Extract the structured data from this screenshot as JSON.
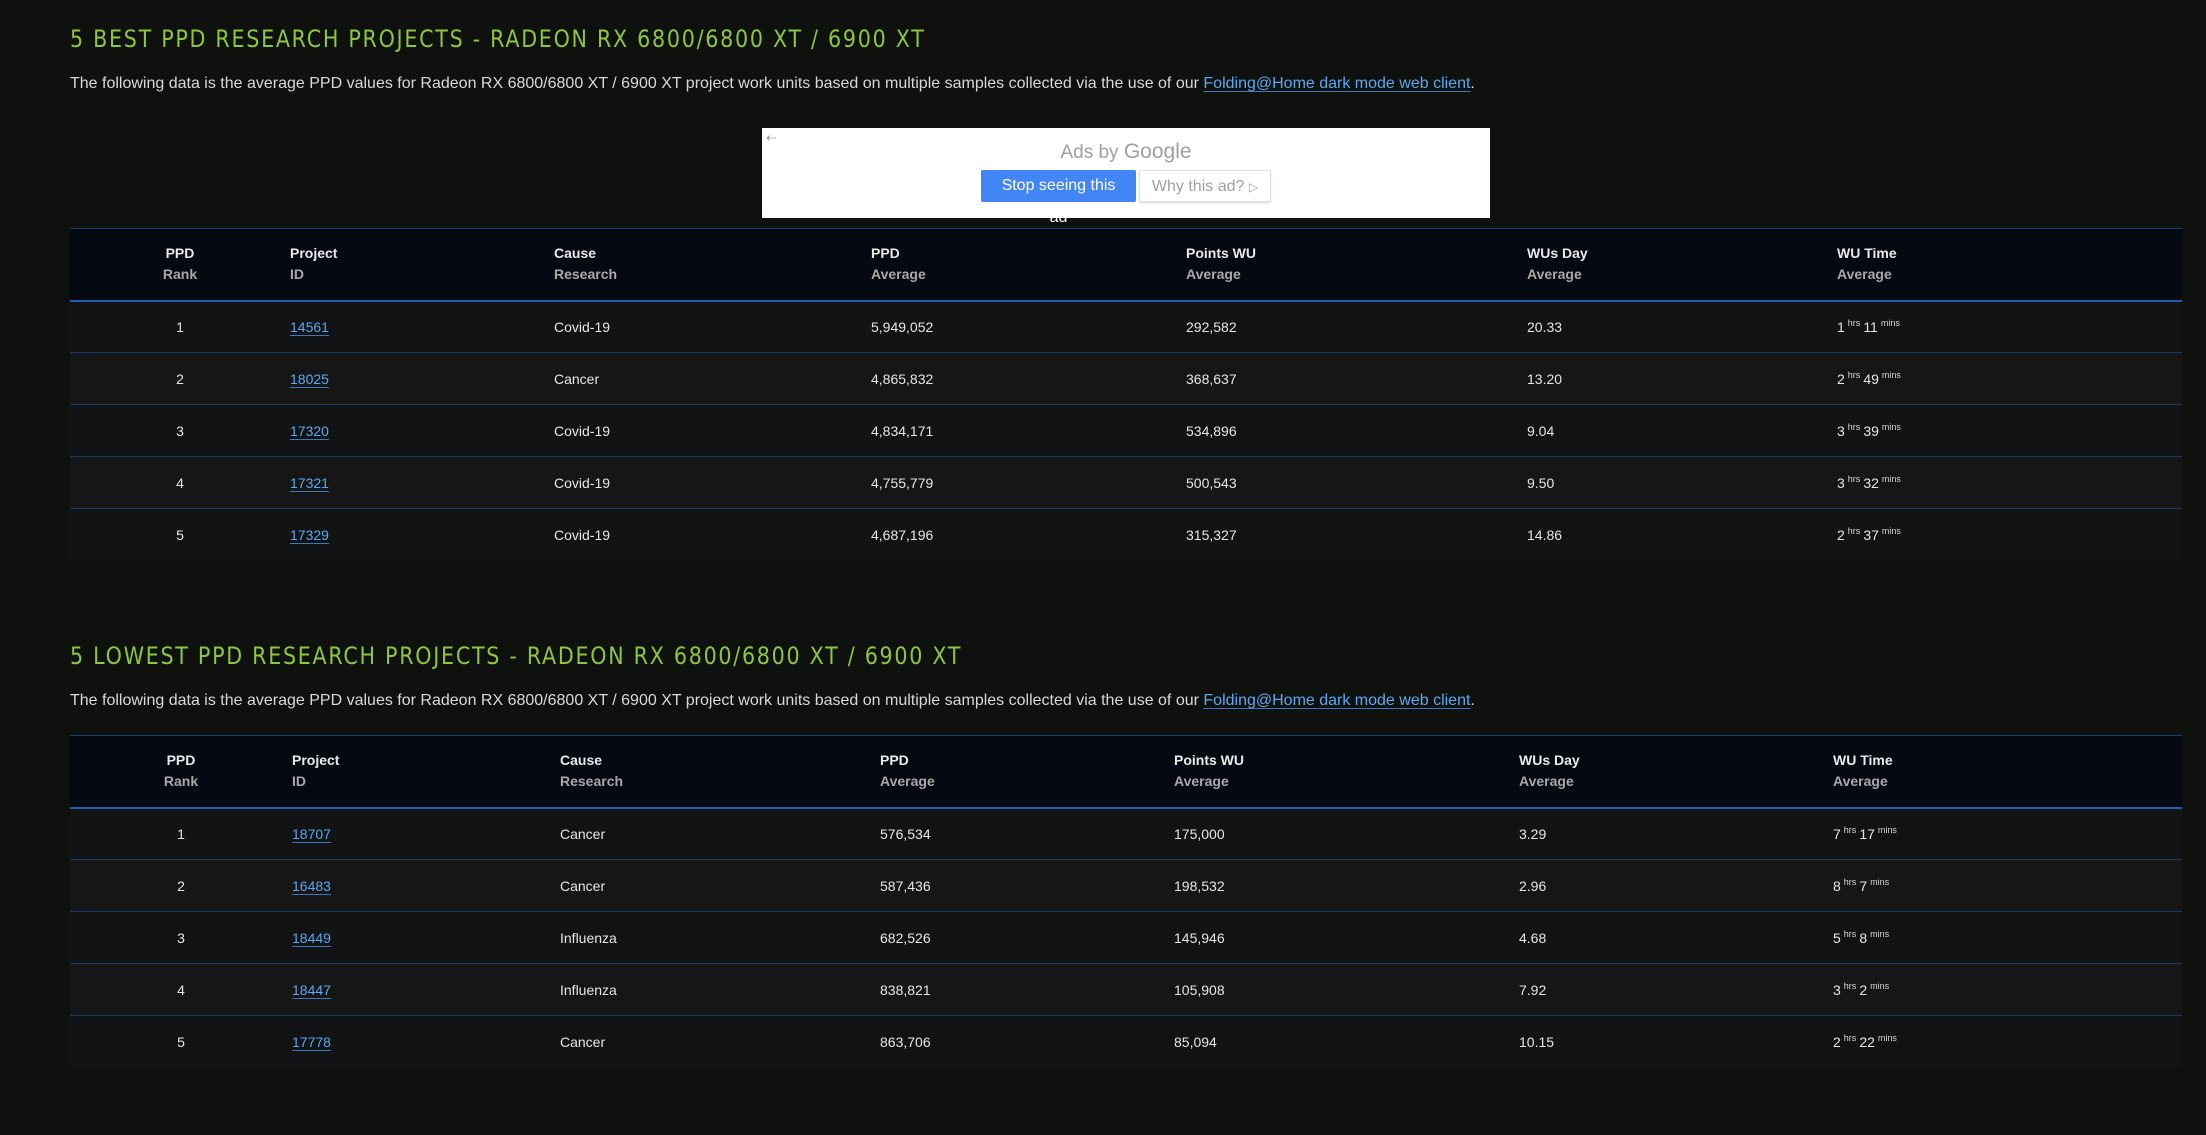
{
  "best": {
    "title": "5 BEST PPD RESEARCH PROJECTS - RADEON RX 6800/6800 XT / 6900 XT",
    "description": "The following data is the average PPD values for Radeon RX 6800/6800 XT / 6900 XT project work units based on multiple samples collected via the use of our ",
    "link_text": "Folding@Home dark mode web client",
    "description_end": ".",
    "rows": [
      {
        "rank": "1",
        "project": "14561",
        "cause": "Covid-19",
        "ppd": "5,949,052",
        "points": "292,582",
        "wus": "20.33",
        "hrs": "1",
        "mins": "11"
      },
      {
        "rank": "2",
        "project": "18025",
        "cause": "Cancer",
        "ppd": "4,865,832",
        "points": "368,637",
        "wus": "13.20",
        "hrs": "2",
        "mins": "49"
      },
      {
        "rank": "3",
        "project": "17320",
        "cause": "Covid-19",
        "ppd": "4,834,171",
        "points": "534,896",
        "wus": "9.04",
        "hrs": "3",
        "mins": "39"
      },
      {
        "rank": "4",
        "project": "17321",
        "cause": "Covid-19",
        "ppd": "4,755,779",
        "points": "500,543",
        "wus": "9.50",
        "hrs": "3",
        "mins": "32"
      },
      {
        "rank": "5",
        "project": "17329",
        "cause": "Covid-19",
        "ppd": "4,687,196",
        "points": "315,327",
        "wus": "14.86",
        "hrs": "2",
        "mins": "37"
      }
    ]
  },
  "lowest": {
    "title": "5 LOWEST PPD RESEARCH PROJECTS - RADEON RX 6800/6800 XT / 6900 XT",
    "description": "The following data is the average PPD values for Radeon RX 6800/6800 XT / 6900 XT project work units based on multiple samples collected via the use of our ",
    "link_text": "Folding@Home dark mode web client",
    "description_end": ".",
    "rows": [
      {
        "rank": "1",
        "project": "18707",
        "cause": "Cancer",
        "ppd": "576,534",
        "points": "175,000",
        "wus": "3.29",
        "hrs": "7",
        "mins": "17"
      },
      {
        "rank": "2",
        "project": "16483",
        "cause": "Cancer",
        "ppd": "587,436",
        "points": "198,532",
        "wus": "2.96",
        "hrs": "8",
        "mins": "7"
      },
      {
        "rank": "3",
        "project": "18449",
        "cause": "Influenza",
        "ppd": "682,526",
        "points": "145,946",
        "wus": "4.68",
        "hrs": "5",
        "mins": "8"
      },
      {
        "rank": "4",
        "project": "18447",
        "cause": "Influenza",
        "ppd": "838,821",
        "points": "105,908",
        "wus": "7.92",
        "hrs": "3",
        "mins": "2"
      },
      {
        "rank": "5",
        "project": "17778",
        "cause": "Cancer",
        "ppd": "863,706",
        "points": "85,094",
        "wus": "10.15",
        "hrs": "2",
        "mins": "22"
      }
    ]
  },
  "table_headers": {
    "rank": [
      "PPD",
      "Rank"
    ],
    "project": [
      "Project",
      "ID"
    ],
    "cause": [
      "Cause",
      "Research"
    ],
    "ppd": [
      "PPD",
      "Average"
    ],
    "points": [
      "Points WU",
      "Average"
    ],
    "wus": [
      "WUs Day",
      "Average"
    ],
    "time": [
      "WU Time",
      "Average"
    ]
  },
  "time_units": {
    "hrs": "hrs",
    "mins": "mins"
  },
  "ad": {
    "back_icon": "back-arrow-icon",
    "label_prefix": "Ads by ",
    "label_brand": "Google",
    "stop_button": "Stop seeing this ad",
    "why_button": "Why this ad?",
    "why_icon": "play-icon",
    "colors": {
      "primary": "#4285f4",
      "text": "#9aa0a6"
    }
  },
  "colors": {
    "background": "#0f110f",
    "title": "#8dc63f",
    "link": "#5aa9f0",
    "border": "#1f5eb0"
  }
}
